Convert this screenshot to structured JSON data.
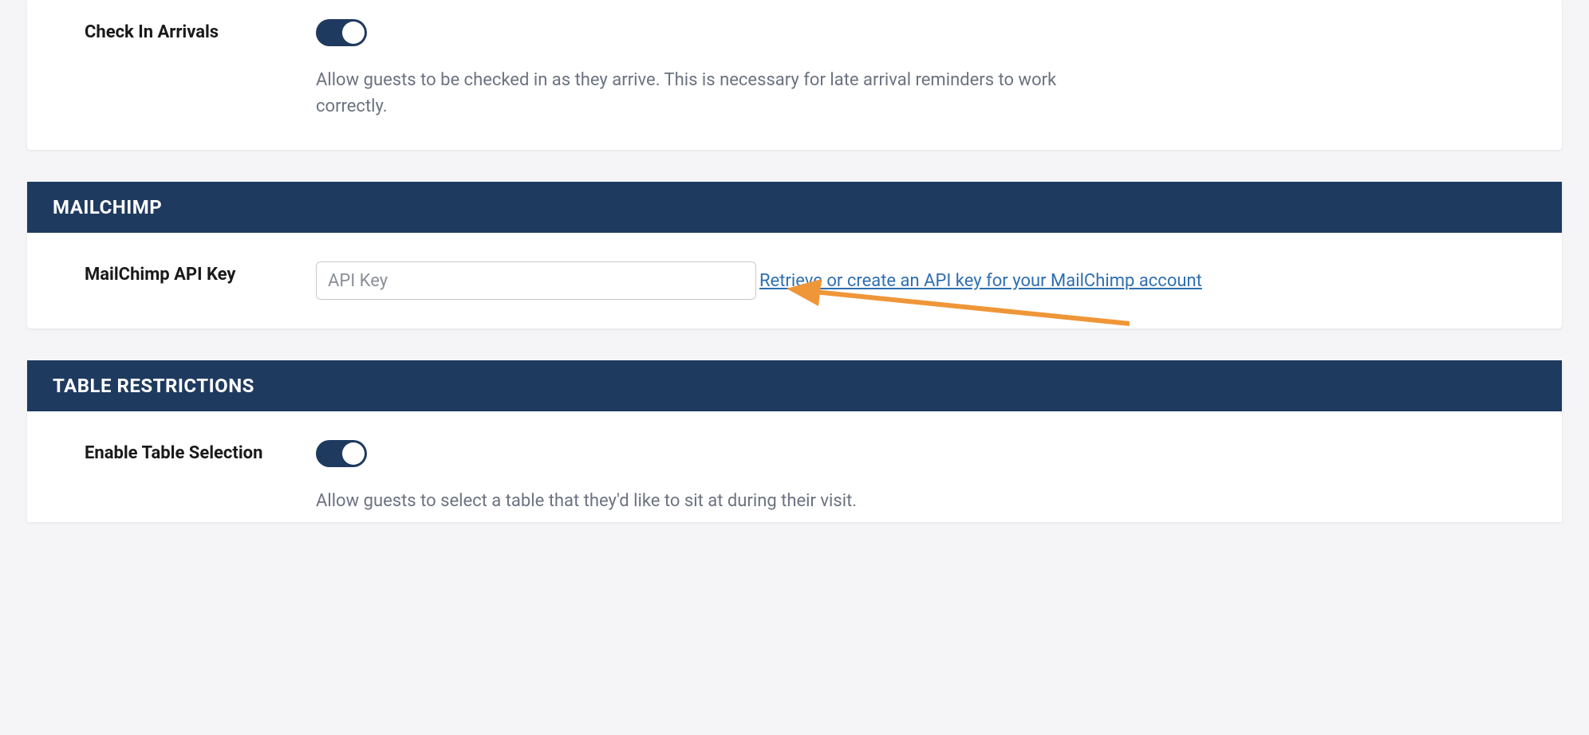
{
  "checkin": {
    "label": "Check In Arrivals",
    "toggle_on": true,
    "help": "Allow guests to be checked in as they arrive. This is necessary for late arrival reminders to work correctly."
  },
  "mailchimp": {
    "header": "MAILCHIMP",
    "api_key_label": "MailChimp API Key",
    "api_key_value": "",
    "api_key_placeholder": "API Key",
    "retrieve_link": "Retrieve or create an API key for your MailChimp account"
  },
  "table_restrictions": {
    "header": "TABLE RESTRICTIONS",
    "enable_label": "Enable Table Selection",
    "toggle_on": true,
    "help": "Allow guests to select a table that they'd like to sit at during their visit."
  },
  "colors": {
    "header_bg": "#1f3a5f",
    "link": "#2f6fb0",
    "arrow": "#ef9638"
  }
}
